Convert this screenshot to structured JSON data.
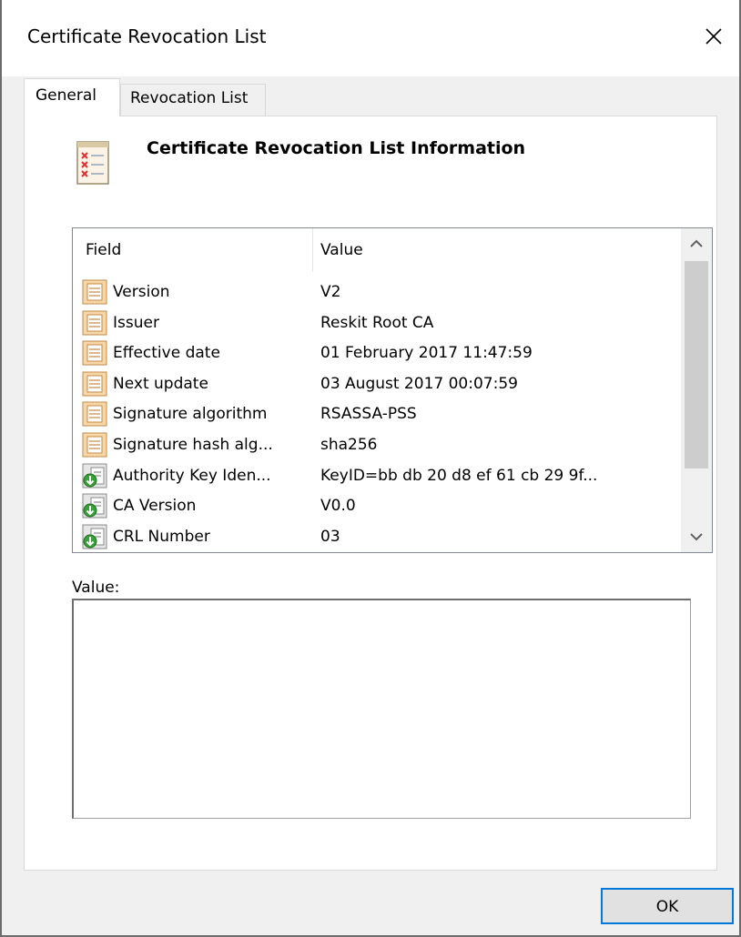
{
  "window": {
    "title": "Certificate Revocation List"
  },
  "tabs": [
    {
      "label": "General",
      "active": true
    },
    {
      "label": "Revocation List",
      "active": false
    }
  ],
  "general": {
    "heading": "Certificate Revocation List Information",
    "heading_icon": "crl-document-icon",
    "columns": {
      "field": "Field",
      "value": "Value"
    },
    "rows": [
      {
        "field": "Version",
        "value": "V2",
        "icon": "field-property-icon"
      },
      {
        "field": "Issuer",
        "value": "Reskit Root CA",
        "icon": "field-property-icon"
      },
      {
        "field": "Effective date",
        "value": "01 February 2017 11:47:59",
        "icon": "field-property-icon"
      },
      {
        "field": "Next update",
        "value": "03 August 2017 00:07:59",
        "icon": "field-property-icon"
      },
      {
        "field": "Signature algorithm",
        "value": "RSASSA-PSS",
        "icon": "field-property-icon"
      },
      {
        "field": "Signature hash alg...",
        "value": "sha256",
        "icon": "field-property-icon"
      },
      {
        "field": "Authority Key Iden...",
        "value": "KeyID=bb db 20 d8 ef 61 cb 29 9f...",
        "icon": "extension-icon"
      },
      {
        "field": "CA Version",
        "value": "V0.0",
        "icon": "extension-icon"
      },
      {
        "field": "CRL Number",
        "value": "03",
        "icon": "extension-icon"
      }
    ],
    "value_label": "Value:",
    "value_text": ""
  },
  "buttons": {
    "ok": "OK"
  }
}
